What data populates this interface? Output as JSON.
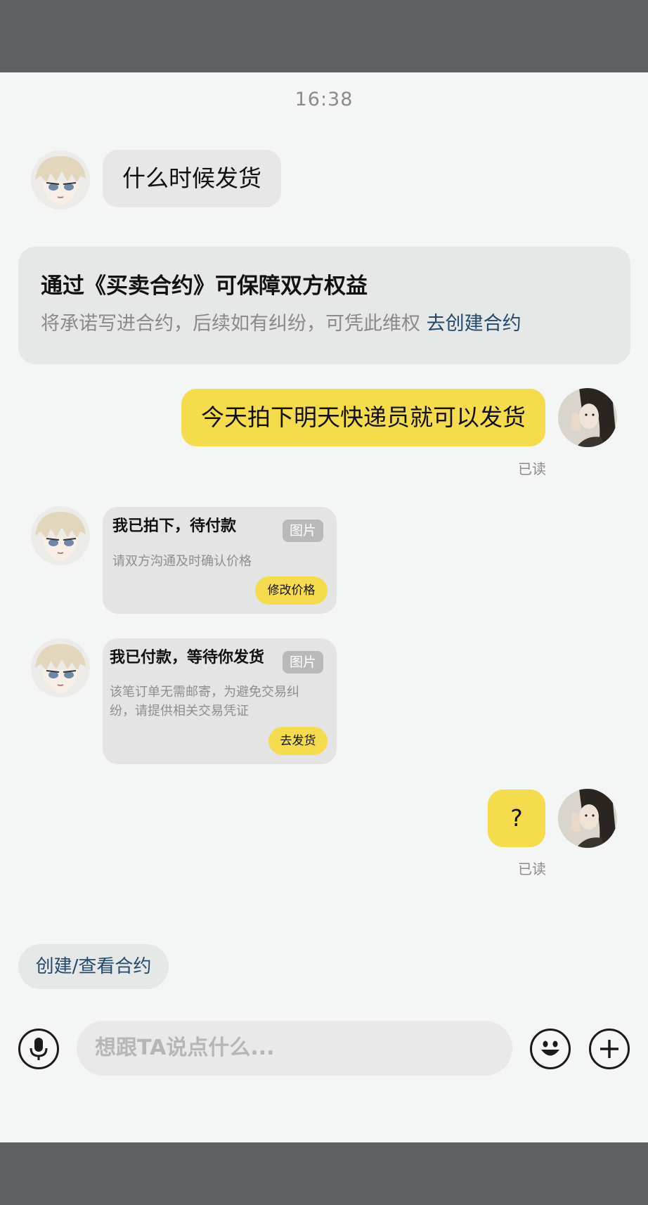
{
  "time": "16:38",
  "messages": {
    "m1": "什么时候发货",
    "m2": "今天拍下明天快递员就可以发货",
    "m3": "?"
  },
  "notice": {
    "title": "通过《买卖合约》可保障双方权益",
    "body": "将承诺写进合约，后续如有纠纷，可凭此维权",
    "link": "去创建合约"
  },
  "read_status": "已读",
  "cards": [
    {
      "title": "我已拍下，待付款",
      "badge": "图片",
      "desc_line1": "请双方沟通及时确认价格",
      "desc_line2": "",
      "button": "修改价格"
    },
    {
      "title": "我已付款，等待你发货",
      "badge": "图片",
      "desc_line1": "该笔订单无需邮寄，为避免交易纠",
      "desc_line2": "纷，请提供相关交易凭证",
      "button": "去发货"
    }
  ],
  "contract_chip": "创建/查看合约",
  "composer": {
    "placeholder": "想跟TA说点什么...",
    "voice_icon": "microphone-icon",
    "emoji_icon": "emoji-icon",
    "plus_icon": "plus-icon"
  },
  "colors": {
    "accent_yellow": "#f5dc4c",
    "link_blue": "#23496b",
    "chrome_gray": "#5e6163"
  }
}
